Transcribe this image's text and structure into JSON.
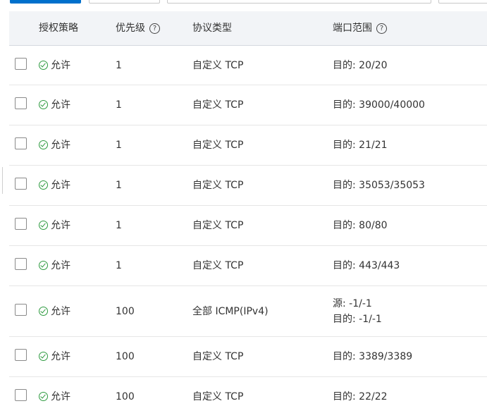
{
  "toolbar": {
    "primary_button": "",
    "secondary_button": "",
    "search_placeholder": "",
    "extra_button": ""
  },
  "table": {
    "headers": {
      "policy": "授权策略",
      "priority": "优先级",
      "protocol": "协议类型",
      "port": "端口范围"
    },
    "rows": [
      {
        "policy": "允许",
        "priority": "1",
        "protocol": "自定义 TCP",
        "port": [
          "目的: 20/20"
        ]
      },
      {
        "policy": "允许",
        "priority": "1",
        "protocol": "自定义 TCP",
        "port": [
          "目的: 39000/40000"
        ]
      },
      {
        "policy": "允许",
        "priority": "1",
        "protocol": "自定义 TCP",
        "port": [
          "目的: 21/21"
        ]
      },
      {
        "policy": "允许",
        "priority": "1",
        "protocol": "自定义 TCP",
        "port": [
          "目的: 35053/35053"
        ]
      },
      {
        "policy": "允许",
        "priority": "1",
        "protocol": "自定义 TCP",
        "port": [
          "目的: 80/80"
        ]
      },
      {
        "policy": "允许",
        "priority": "1",
        "protocol": "自定义 TCP",
        "port": [
          "目的: 443/443"
        ]
      },
      {
        "policy": "允许",
        "priority": "100",
        "protocol": "全部 ICMP(IPv4)",
        "port": [
          "源: -1/-1",
          "目的: -1/-1"
        ]
      },
      {
        "policy": "允许",
        "priority": "100",
        "protocol": "自定义 TCP",
        "port": [
          "目的: 3389/3389"
        ]
      },
      {
        "policy": "允许",
        "priority": "100",
        "protocol": "自定义 TCP",
        "port": [
          "目的: 22/22"
        ]
      }
    ]
  },
  "colors": {
    "primary": "#0070cc",
    "allow_green": "#2d9a3f",
    "header_bg": "#f2f4f7",
    "row_border": "#e6e6e6"
  },
  "icons": {
    "allow": "check-circle-icon",
    "help": "question-circle-icon"
  }
}
